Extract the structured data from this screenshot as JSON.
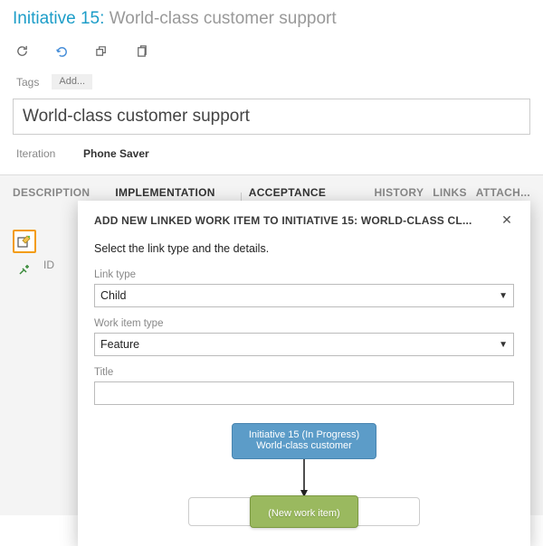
{
  "header": {
    "prefix": "Initiative 15:",
    "title": "World-class customer support"
  },
  "tags": {
    "label": "Tags",
    "add": "Add..."
  },
  "summary": "World-class customer support",
  "iteration": {
    "label": "Iteration",
    "value": "Phone Saver"
  },
  "tabs": {
    "description": "DESCRIPTION",
    "implementation": "IMPLEMENTATION",
    "acceptance": "ACCEPTANCE CRITERIA",
    "history": "HISTORY",
    "links": "LINKS",
    "attach": "ATTACH..."
  },
  "id_label": "ID",
  "dialog": {
    "title": "ADD NEW LINKED WORK ITEM TO INITIATIVE 15: WORLD-CLASS CL...",
    "instruction": "Select the link type and the details.",
    "link_type_label": "Link type",
    "link_type_value": "Child",
    "work_item_type_label": "Work item type",
    "work_item_type_value": "Feature",
    "title_label": "Title",
    "title_value": "",
    "diagram": {
      "parent_line1": "Initiative 15 (In Progress)",
      "parent_line2": "World-class customer",
      "new_item": "(New work item)"
    }
  }
}
